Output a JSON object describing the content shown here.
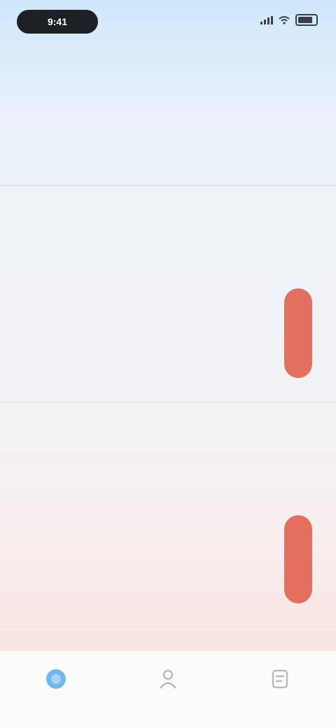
{
  "status_bar": {
    "time": "9:41"
  },
  "header": {
    "title": ""
  },
  "date_strip": {
    "days": [
      "",
      "",
      "",
      "",
      "",
      "",
      ""
    ]
  },
  "charts": [
    {
      "title": "",
      "subtitle": "",
      "axis": [
        "",
        "",
        "",
        "",
        "",
        "",
        ""
      ]
    },
    {
      "title": "",
      "subtitle": "",
      "axis": [
        "",
        "",
        "",
        "",
        "",
        "",
        ""
      ]
    }
  ],
  "tabs": [
    {
      "label": "",
      "icon": "circle-icon",
      "active": true
    },
    {
      "label": "",
      "icon": "person-icon",
      "active": false
    },
    {
      "label": "",
      "icon": "list-icon",
      "active": false
    }
  ],
  "colors": {
    "bar": "#e3705f",
    "accent": "#4ba3e3"
  }
}
